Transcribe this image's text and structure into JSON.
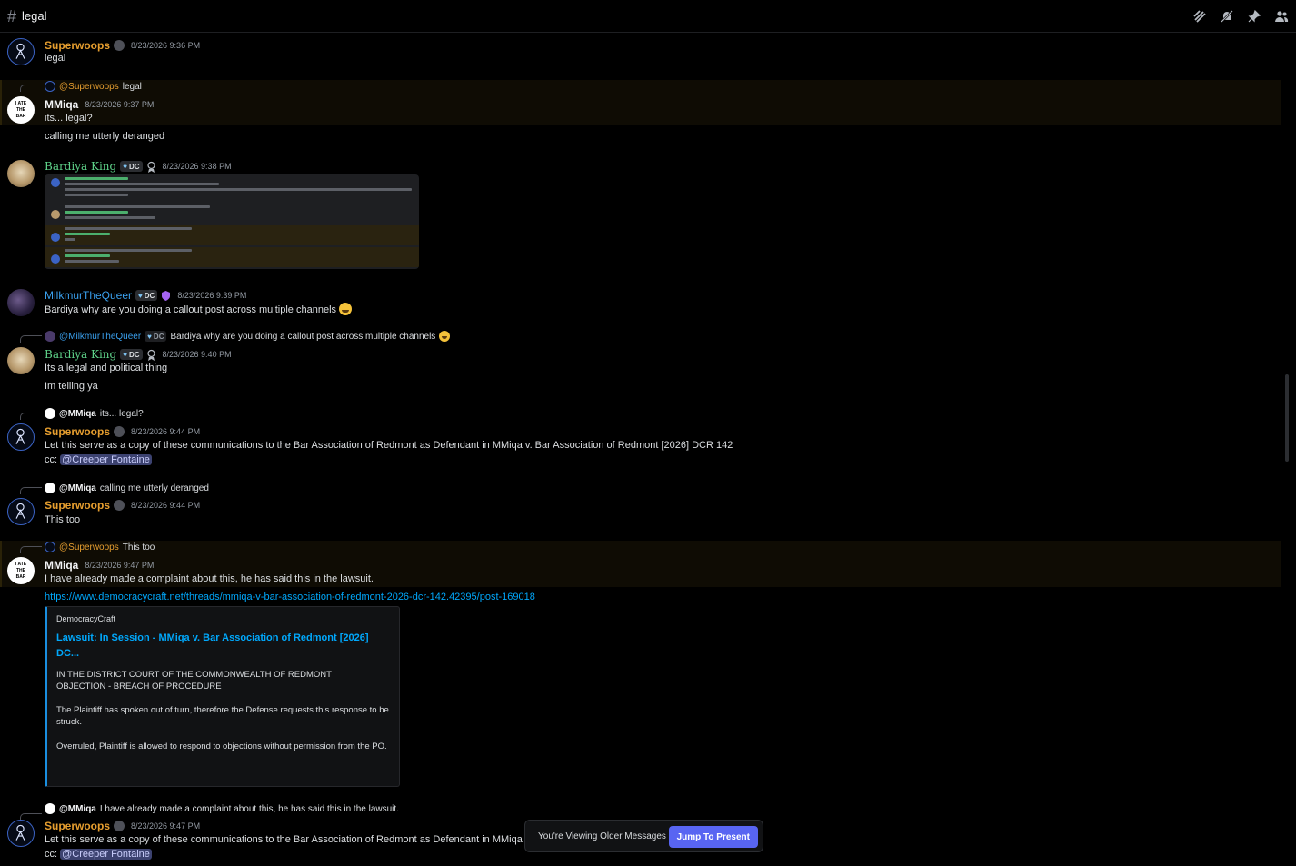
{
  "channel": {
    "name": "legal"
  },
  "header_icons": [
    "threads-icon",
    "mute-icon",
    "pin-icon",
    "members-icon"
  ],
  "messages": [
    {
      "author": "Superwoops",
      "time": "8/23/2026 9:36 PM",
      "lines": [
        "legal"
      ]
    },
    {
      "reply_to": "@Superwoops",
      "reply_text": "legal",
      "author": "MMiqa",
      "time": "8/23/2026 9:37 PM",
      "lines": [
        "its... legal?",
        "calling me utterly deranged"
      ]
    },
    {
      "author": "Bardiya King",
      "tag": "DC",
      "time": "8/23/2026 9:38 PM"
    },
    {
      "author": "MilkmurTheQueer",
      "tag": "DC",
      "time": "8/23/2026 9:39 PM",
      "lines": [
        "Bardiya why are you doing a callout post across multiple channels"
      ]
    },
    {
      "reply_to": "@MilkmurTheQueer",
      "reply_tag": "DC",
      "reply_text": "Bardiya why are you doing a callout post across multiple channels",
      "author": "Bardiya King",
      "tag": "DC",
      "time": "8/23/2026 9:40 PM",
      "lines": [
        "Its a legal and political thing",
        "Im telling ya"
      ]
    },
    {
      "reply_to": "@MMiqa",
      "reply_text": "its... legal?",
      "author": "Superwoops",
      "time": "8/23/2026 9:44 PM",
      "lines": [
        "Let this serve as a copy of these communications to the Bar Association of Redmont as Defendant in MMiqa v. Bar Association of Redmont [2026] DCR 142"
      ],
      "cc_label": "cc:",
      "cc_mention": "@Creeper Fontaine"
    },
    {
      "reply_to": "@MMiqa",
      "reply_text": "calling me utterly deranged",
      "author": "Superwoops",
      "time": "8/23/2026 9:44 PM",
      "lines": [
        "This too"
      ]
    },
    {
      "reply_to": "@Superwoops",
      "reply_text": "This too",
      "author": "MMiqa",
      "time": "8/23/2026 9:47 PM",
      "lines": [
        "I have already made a complaint about this, he has said this in the lawsuit."
      ],
      "link": "https://www.democracycraft.net/threads/mmiqa-v-bar-association-of-redmont-2026-dcr-142.42395/post-169018",
      "embed": {
        "provider": "DemocracyCraft",
        "title": "Lawsuit: In Session - MMiqa v. Bar Association of Redmont [2026] DC...",
        "desc": [
          "IN THE DISTRICT COURT OF THE COMMONWEALTH OF REDMONT",
          "OBJECTION - BREACH OF PROCEDURE",
          "The Plaintiff has spoken out of turn, therefore the Defense requests this response to be struck.",
          "Overruled, Plaintiff is allowed to respond to objections without permission from the PO."
        ]
      }
    },
    {
      "reply_to": "@MMiqa",
      "reply_text": "I have already made a complaint about this, he has said this in the lawsuit.",
      "author": "Superwoops",
      "time": "8/23/2026 9:47 PM",
      "lines": [
        "Let this serve as a copy of these communications to the Bar Association of Redmont as Defendant in MMiqa v. Bar Association of Redmont [2026] DCR 142"
      ],
      "cc_label": "cc:",
      "cc_mention": "@Creeper Fontaine"
    }
  ],
  "avatars": {
    "mmiqa_text": "I ATE THE BAR"
  },
  "older_bar": {
    "text": "You're Viewing Older Messages",
    "button": "Jump To Present"
  }
}
